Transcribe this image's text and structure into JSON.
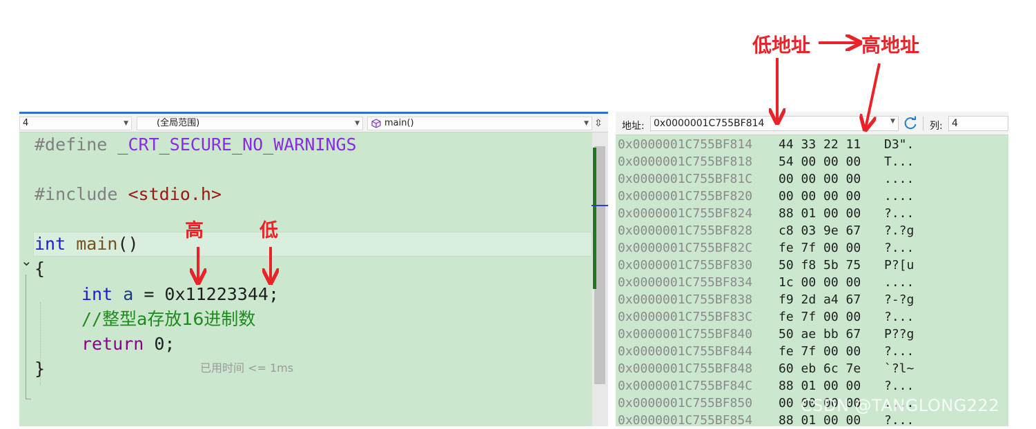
{
  "editor": {
    "nav": {
      "combo1": "4",
      "combo2": "(全局范围)",
      "combo3": "main()"
    },
    "code": {
      "define_kw": "#define",
      "define_macro": "_CRT_SECURE_NO_WARNINGS",
      "include_kw": "#include",
      "include_file": "<stdio.h>",
      "main_type": "int",
      "main_name": "main",
      "main_parens": "()",
      "open_brace": "{",
      "decl_type": "int",
      "decl_var": "a",
      "decl_rest": " = 0x11223344;",
      "comment_prefix": "//",
      "comment_text": "整型a存放16进制数",
      "return_kw": "return",
      "return_val": " 0;",
      "perf_tip": "已用时间 <= 1ms",
      "close_brace": "}"
    }
  },
  "memory": {
    "address_label": "地址:",
    "address_value": "0x0000001C755BF814",
    "columns_label": "列:",
    "columns_value": "4",
    "rows": [
      {
        "addr": "0x0000001C755BF814",
        "hex": "44 33 22 11",
        "chars": "D3\"."
      },
      {
        "addr": "0x0000001C755BF818",
        "hex": "54 00 00 00",
        "chars": "T..."
      },
      {
        "addr": "0x0000001C755BF81C",
        "hex": "00 00 00 00",
        "chars": "...."
      },
      {
        "addr": "0x0000001C755BF820",
        "hex": "00 00 00 00",
        "chars": "...."
      },
      {
        "addr": "0x0000001C755BF824",
        "hex": "88 01 00 00",
        "chars": "?..."
      },
      {
        "addr": "0x0000001C755BF828",
        "hex": "c8 03 9e 67",
        "chars": "?.?g"
      },
      {
        "addr": "0x0000001C755BF82C",
        "hex": "fe 7f 00 00",
        "chars": "?..."
      },
      {
        "addr": "0x0000001C755BF830",
        "hex": "50 f8 5b 75",
        "chars": "P?[u"
      },
      {
        "addr": "0x0000001C755BF834",
        "hex": "1c 00 00 00",
        "chars": "...."
      },
      {
        "addr": "0x0000001C755BF838",
        "hex": "f9 2d a4 67",
        "chars": "?-?g"
      },
      {
        "addr": "0x0000001C755BF83C",
        "hex": "fe 7f 00 00",
        "chars": "?..."
      },
      {
        "addr": "0x0000001C755BF840",
        "hex": "50 ae bb 67",
        "chars": "P??g"
      },
      {
        "addr": "0x0000001C755BF844",
        "hex": "fe 7f 00 00",
        "chars": "?..."
      },
      {
        "addr": "0x0000001C755BF848",
        "hex": "60 eb 6c 7e",
        "chars": "`?l~"
      },
      {
        "addr": "0x0000001C755BF84C",
        "hex": "88 01 00 00",
        "chars": "?..."
      },
      {
        "addr": "0x0000001C755BF850",
        "hex": "00 00 00 00",
        "chars": "...."
      },
      {
        "addr": "0x0000001C755BF854",
        "hex": "88 01 00 00",
        "chars": "?..."
      }
    ]
  },
  "annotations": {
    "low_address": "低地址",
    "high_address": "高地址",
    "high": "高",
    "low": "低",
    "color": "#e8242a"
  },
  "watermark": "CSDN @TANGLONG222"
}
